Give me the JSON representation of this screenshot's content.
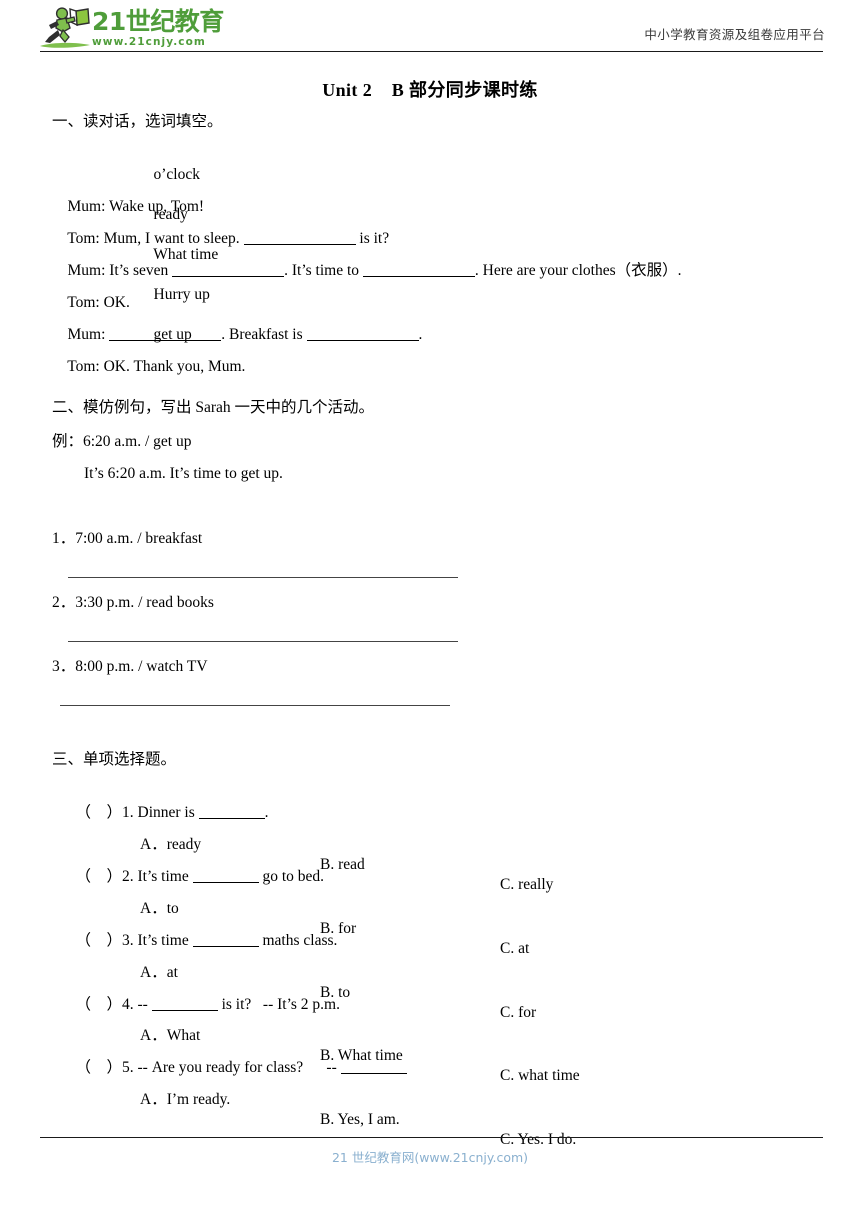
{
  "header": {
    "logo_main": "21世纪教育",
    "logo_url": "www.21cnjy.com",
    "logo_icon": "running-person-with-book-icon",
    "tagline": "中小学教育资源及组卷应用平台",
    "brand_green": "#4f9d3a"
  },
  "title": "Unit 2    B 部分同步课时练",
  "section1": {
    "heading": "一、读对话，选词填空。",
    "word_bank": [
      "o’clock",
      "ready",
      "What time",
      "Hurry up",
      "get up"
    ],
    "dialogue": [
      {
        "speaker_line": "Mum: Wake up, Tom!"
      },
      {
        "pre": "Tom: Mum, I want to sleep. ",
        "post": " is it?"
      },
      {
        "pre": "Mum: It’s seven ",
        "mid": ". It’s time to ",
        "post": ". Here are your clothes（衣服）."
      },
      {
        "speaker_line": "Tom: OK."
      },
      {
        "pre": "Mum: ",
        "mid": ". Breakfast is ",
        "post": "."
      },
      {
        "speaker_line": "Tom: OK. Thank you, Mum."
      }
    ]
  },
  "section2": {
    "heading": "二、模仿例句，写出 Sarah 一天中的几个活动。",
    "example_prompt": "例：6:20 a.m. / get up",
    "example_answer": "It’s 6:20 a.m. It’s time to get up.",
    "items": [
      "1．7:00 a.m. / breakfast",
      "2．3:30 p.m. / read books",
      "3．8:00 p.m. / watch TV"
    ]
  },
  "section3": {
    "heading": "三、单项选择题。",
    "questions": [
      {
        "stem_pre": "（    ）1. Dinner is ",
        "stem_post": ".",
        "a": "A．ready",
        "b": "B. read",
        "c": "C. really"
      },
      {
        "stem_pre": "（    ）2. It’s time ",
        "stem_post": " go to bed.",
        "a": "A．to",
        "b": "B. for",
        "c": "C. at"
      },
      {
        "stem_pre": "（    ）3. It’s time ",
        "stem_post": " maths class.",
        "a": "A．at",
        "b": "B. to",
        "c": "C. for"
      },
      {
        "stem_pre": "（    ）4. -- ",
        "stem_post": " is it?   -- It’s 2 p.m.",
        "a": "A．What",
        "b": "B. What time",
        "c": "C. what time"
      },
      {
        "stem_pre": "（    ）5. -- Are you ready for class?      -- ",
        "stem_post": "",
        "a": "A．I’m ready.",
        "b": "B. Yes, I am.",
        "c": "C. Yes. I do."
      }
    ]
  },
  "footer": {
    "text": "21 世纪教育网(www.21cnjy.com)",
    "color": "#8ab0cf"
  }
}
